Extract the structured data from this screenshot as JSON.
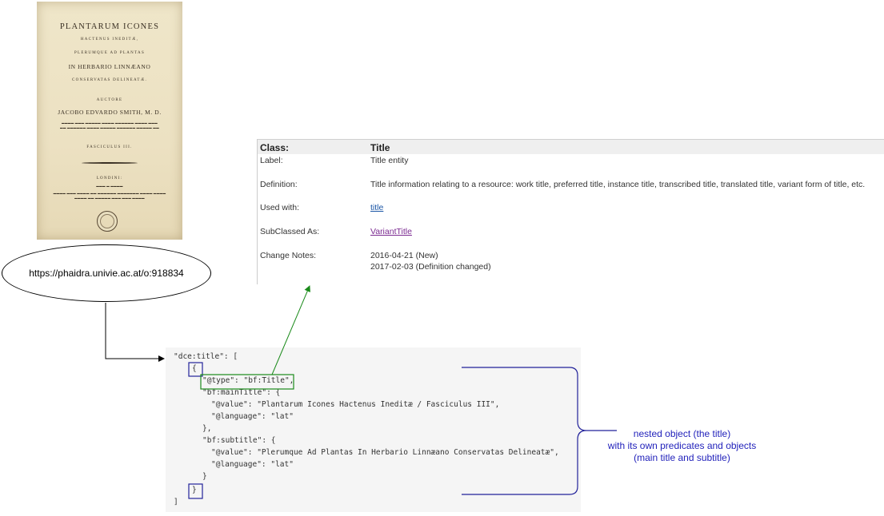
{
  "cover": {
    "lines": [
      "PLANTARUM ICONES",
      "HACTENUS INEDITÆ,",
      "PLERUMQUE AD PLANTAS",
      "IN HERBARIO LINNÆANO",
      "CONSERVATAS DELINEATÆ.",
      "AUCTORE",
      "JACOBO EDVARDO SMITH, M. D."
    ],
    "fasciculus": "FASCICULUS III.",
    "imprint": "LONDINI:"
  },
  "uri": "https://phaidra.univie.ac.at/o:918834",
  "class_table": {
    "class_label": "Class:",
    "class_value": "Title",
    "rows": [
      {
        "key": "Label:",
        "value": "Title entity"
      },
      {
        "key": "Definition:",
        "value": "Title information relating to a resource: work title, preferred title, instance title, transcribed title, translated title, variant form of title, etc."
      },
      {
        "key": "Used with:",
        "value": "title"
      },
      {
        "key": "SubClassed As:",
        "value": "VariantTitle"
      },
      {
        "key": "Change Notes:",
        "value": "2016-04-21 (New)",
        "value2": "2017-02-03 (Definition changed)"
      }
    ]
  },
  "code": {
    "lines": [
      "\"dce:title\": [",
      "{",
      "\"@type\": \"bf:Title\",",
      "\"bf:mainTitle\": {",
      "\"@value\": \"Plantarum Icones Hactenus Ineditæ / Fasciculus III\",",
      "\"@language\": \"lat\"",
      "},",
      "\"bf:subtitle\": {",
      "\"@value\": \"Plerumque Ad Plantas In Herbario Linnæano Conservatas Delineatæ\",",
      "\"@language\": \"lat\"",
      "}",
      "}",
      "]"
    ]
  },
  "annotation": {
    "line1": "nested object (the title)",
    "line2": "with its own predicates and objects",
    "line3": "(main title and subtitle)"
  },
  "colors": {
    "arrow_black": "#000000",
    "arrow_green": "#1a8a1a",
    "box_blue": "#22229a",
    "box_green": "#1a8a1a",
    "note_blue": "#2222bb"
  }
}
